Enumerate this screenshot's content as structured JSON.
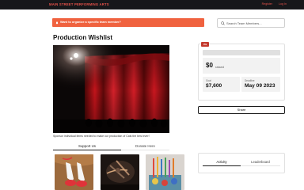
{
  "header": {
    "brand": "MAIN STREET PERFORMING ARTS",
    "nav": [
      "Register",
      "Log In"
    ]
  },
  "banner": {
    "text": "Want to organize a specific team member?",
    "icon": "bell-icon"
  },
  "search": {
    "placeholder": "Search Team Members...",
    "value": ""
  },
  "page": {
    "title": "Production Wishlist",
    "caption": "Sponsor individual items needed to make our production of Cats the best ever!"
  },
  "tabs": {
    "support": "Support Us",
    "donate": "Donate Here"
  },
  "products": [
    {
      "alt": "ballet-shoes"
    },
    {
      "alt": "craft-supplies"
    },
    {
      "alt": "paint-brushes"
    }
  ],
  "fundraiser": {
    "badge": "0%",
    "progress_fraction": 0.0,
    "raised_amount": "$0",
    "raised_label": "raised",
    "goal_label": "Goal",
    "goal_value": "$7,600",
    "deadline_label": "Deadline",
    "deadline_value": "May 09 2023"
  },
  "share": {
    "label": "Share"
  },
  "activity": {
    "tab_activity": "Activity",
    "tab_leaderboard": "Leaderboard"
  },
  "colors": {
    "accent": "#f0623f",
    "brand_red": "#e8524a",
    "topbar": "#17171a"
  }
}
